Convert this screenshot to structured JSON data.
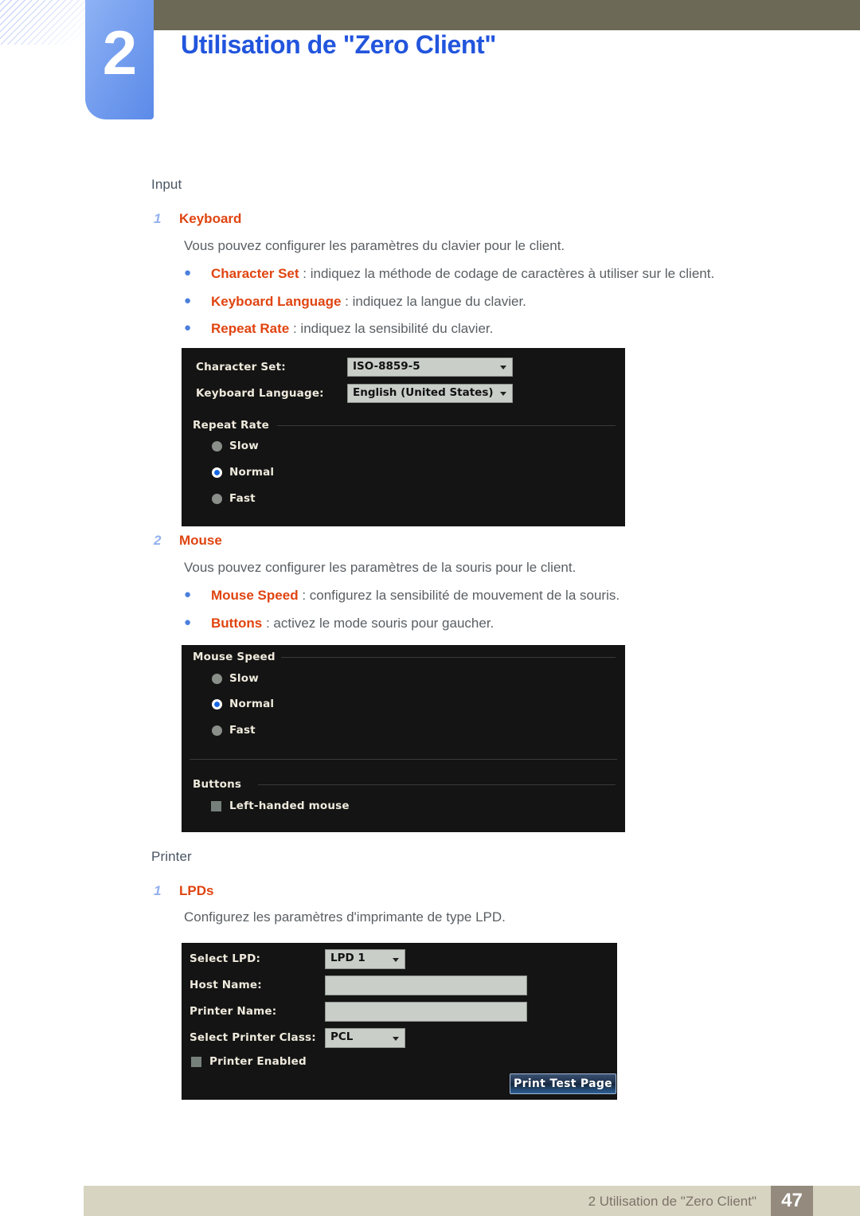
{
  "header": {
    "chapter_number": "2",
    "chapter_title": "Utilisation de \"Zero Client\"",
    "accent_blue": "#2255dd",
    "badge_blue": "#5b8ae8",
    "olive": "#6c6a57"
  },
  "sections": [
    {
      "label": "Input",
      "items": [
        {
          "num": "1",
          "heading": "Keyboard",
          "intro": "Vous pouvez configurer les paramètres du clavier pour le client.",
          "bullets": [
            {
              "term": "Character Set",
              "rest": " : indiquez la méthode de codage de caractères à utiliser sur le client."
            },
            {
              "term": "Keyboard Language",
              "rest": " : indiquez la langue du clavier."
            },
            {
              "term": "Repeat Rate",
              "rest": " : indiquez la sensibilité du clavier."
            }
          ]
        },
        {
          "num": "2",
          "heading": "Mouse",
          "intro": "Vous pouvez configurer les paramètres de la souris pour le client.",
          "bullets": [
            {
              "term": "Mouse Speed",
              "rest": " : configurez la sensibilité de mouvement de la souris."
            },
            {
              "term": "Buttons",
              "rest": " : activez le mode souris pour gaucher."
            }
          ]
        }
      ]
    },
    {
      "label": "Printer",
      "items": [
        {
          "num": "1",
          "heading": "LPDs",
          "intro": "Configurez les paramètres d'imprimante de type LPD.",
          "bullets": []
        }
      ]
    }
  ],
  "keyboard_panel": {
    "character_set_label": "Character Set:",
    "character_set_value": "ISO-8859-5",
    "keyboard_language_label": "Keyboard Language:",
    "keyboard_language_value": "English (United States)",
    "repeat_rate_group": "Repeat Rate",
    "radios": [
      {
        "label": "Slow",
        "selected": false
      },
      {
        "label": "Normal",
        "selected": true
      },
      {
        "label": "Fast",
        "selected": false
      }
    ]
  },
  "mouse_panel": {
    "mouse_speed_group": "Mouse Speed",
    "radios": [
      {
        "label": "Slow",
        "selected": false
      },
      {
        "label": "Normal",
        "selected": true
      },
      {
        "label": "Fast",
        "selected": false
      }
    ],
    "buttons_group": "Buttons",
    "left_handed_label": "Left-handed mouse",
    "left_handed_checked": false
  },
  "lpd_panel": {
    "select_lpd_label": "Select LPD:",
    "select_lpd_value": "LPD 1",
    "host_name_label": "Host Name:",
    "host_name_value": "",
    "printer_name_label": "Printer Name:",
    "printer_name_value": "",
    "printer_class_label": "Select Printer Class:",
    "printer_class_value": "PCL",
    "printer_enabled_label": "Printer Enabled",
    "printer_enabled_checked": false,
    "print_test_page_label": "Print Test Page"
  },
  "footer": {
    "text": "2 Utilisation de \"Zero Client\"",
    "page": "47"
  }
}
